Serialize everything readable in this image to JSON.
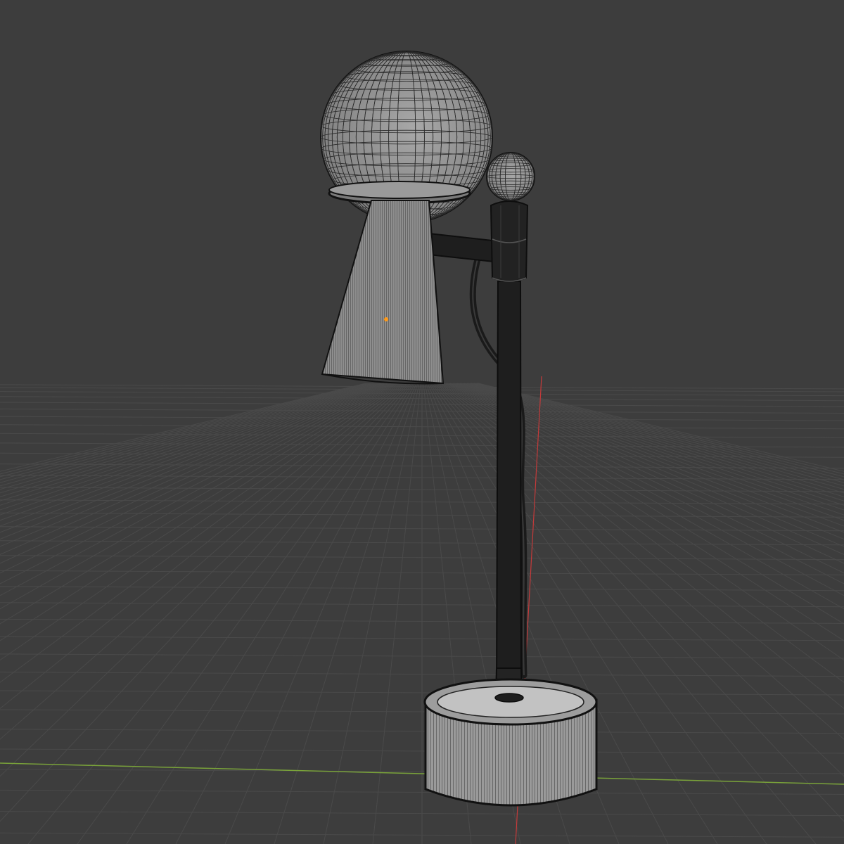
{
  "viewport": {
    "background_color": "#3d3d3d",
    "grid_color": "#4a4a4a",
    "x_axis_color": "#c43a3a",
    "y_axis_color": "#7aa33a",
    "origin_marker_color": "#ff9a1a"
  },
  "model": {
    "wire_color": "#1a1a1a",
    "light_surface_color": "#9a9a9a",
    "dark_surface_color": "#1e1e1e"
  }
}
